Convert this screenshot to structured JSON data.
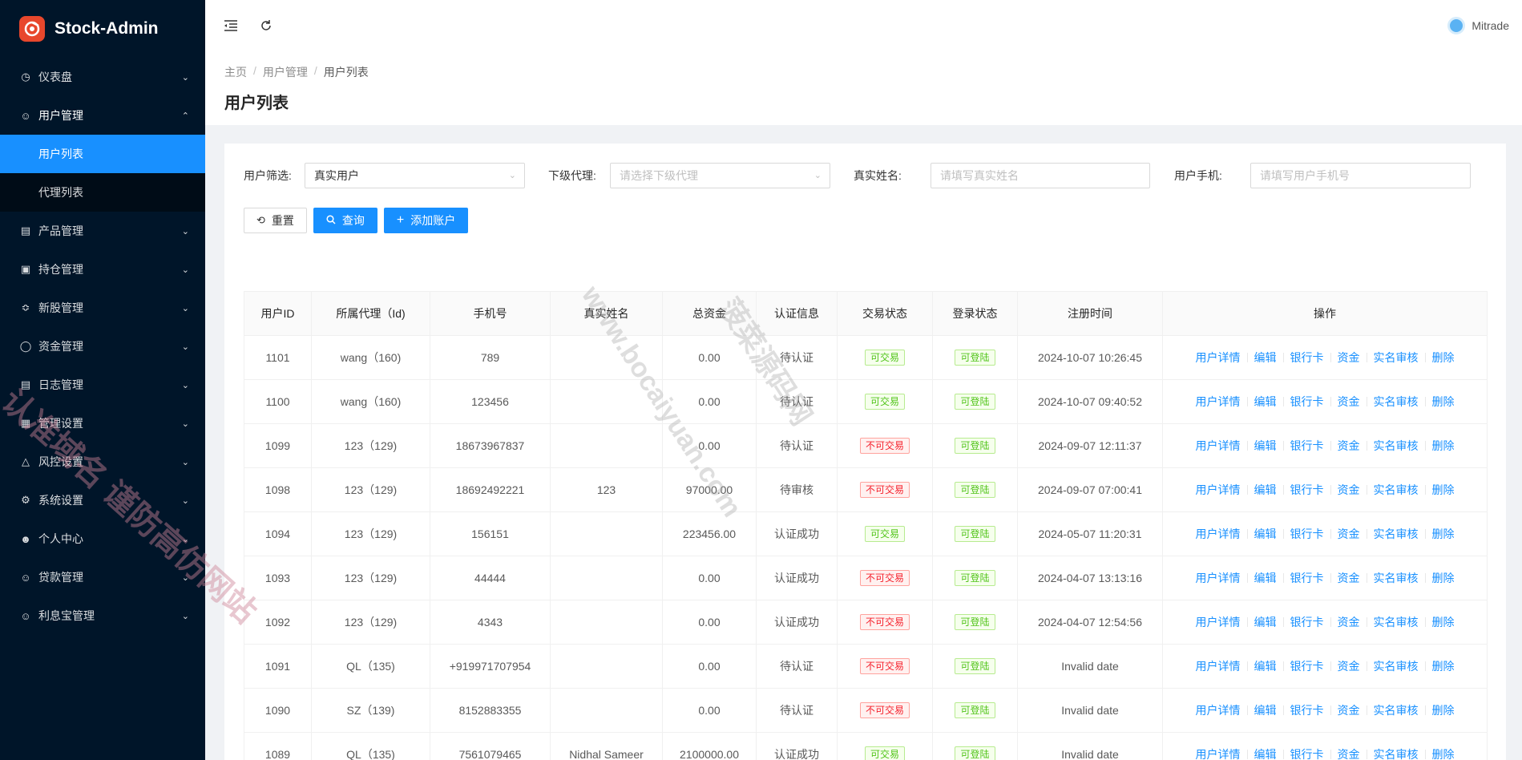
{
  "app": {
    "name": "Stock-Admin"
  },
  "sidebar": {
    "items": [
      {
        "label": "仪表盘",
        "icon": "dashboard-icon"
      },
      {
        "label": "用户管理",
        "icon": "user-group-icon",
        "open": true,
        "children": [
          {
            "label": "用户列表",
            "active": true
          },
          {
            "label": "代理列表"
          }
        ]
      },
      {
        "label": "产品管理",
        "icon": "bar-chart-icon"
      },
      {
        "label": "持仓管理",
        "icon": "position-icon"
      },
      {
        "label": "新股管理",
        "icon": "new-stock-icon"
      },
      {
        "label": "资金管理",
        "icon": "money-icon"
      },
      {
        "label": "日志管理",
        "icon": "log-icon"
      },
      {
        "label": "管理设置",
        "icon": "admin-settings-icon"
      },
      {
        "label": "风控设置",
        "icon": "warning-icon"
      },
      {
        "label": "系统设置",
        "icon": "gear-icon"
      },
      {
        "label": "个人中心",
        "icon": "user-icon"
      },
      {
        "label": "贷款管理",
        "icon": "loan-icon"
      },
      {
        "label": "利息宝管理",
        "icon": "interest-icon"
      }
    ]
  },
  "header": {
    "username": "Mitrade"
  },
  "breadcrumb": [
    "主页",
    "用户管理",
    "用户列表"
  ],
  "page_title": "用户列表",
  "filters": {
    "user_filter_label": "用户筛选:",
    "user_filter_value": "真实用户",
    "agent_label": "下级代理:",
    "agent_placeholder": "请选择下级代理",
    "realname_label": "真实姓名:",
    "realname_placeholder": "请填写真实姓名",
    "phone_label": "用户手机:",
    "phone_placeholder": "请填写用户手机号"
  },
  "buttons": {
    "reset": "重置",
    "query": "查询",
    "add": "添加账户"
  },
  "table": {
    "columns": [
      "用户ID",
      "所属代理（Id)",
      "手机号",
      "真实姓名",
      "总资金",
      "认证信息",
      "交易状态",
      "登录状态",
      "注册时间",
      "操作"
    ],
    "actions": [
      "用户详情",
      "编辑",
      "银行卡",
      "资金",
      "实名审核",
      "删除"
    ],
    "rows": [
      {
        "id": "1101",
        "agent": "wang（160)",
        "phone": "789",
        "name": "",
        "funds": "0.00",
        "auth": "待认证",
        "trade": "可交易",
        "trade_ok": true,
        "login": "可登陆",
        "time": "2024-10-07 10:26:45"
      },
      {
        "id": "1100",
        "agent": "wang（160)",
        "phone": "123456",
        "name": "",
        "funds": "0.00",
        "auth": "待认证",
        "trade": "可交易",
        "trade_ok": true,
        "login": "可登陆",
        "time": "2024-10-07 09:40:52"
      },
      {
        "id": "1099",
        "agent": "123（129)",
        "phone": "18673967837",
        "name": "",
        "funds": "0.00",
        "auth": "待认证",
        "trade": "不可交易",
        "trade_ok": false,
        "login": "可登陆",
        "time": "2024-09-07 12:11:37"
      },
      {
        "id": "1098",
        "agent": "123（129)",
        "phone": "18692492221",
        "name": "123",
        "funds": "97000.00",
        "auth": "待审核",
        "trade": "不可交易",
        "trade_ok": false,
        "login": "可登陆",
        "time": "2024-09-07 07:00:41"
      },
      {
        "id": "1094",
        "agent": "123（129)",
        "phone": "156151",
        "name": "",
        "funds": "223456.00",
        "auth": "认证成功",
        "trade": "可交易",
        "trade_ok": true,
        "login": "可登陆",
        "time": "2024-05-07 11:20:31"
      },
      {
        "id": "1093",
        "agent": "123（129)",
        "phone": "44444",
        "name": "",
        "funds": "0.00",
        "auth": "认证成功",
        "trade": "不可交易",
        "trade_ok": false,
        "login": "可登陆",
        "time": "2024-04-07 13:13:16"
      },
      {
        "id": "1092",
        "agent": "123（129)",
        "phone": "4343",
        "name": "",
        "funds": "0.00",
        "auth": "认证成功",
        "trade": "不可交易",
        "trade_ok": false,
        "login": "可登陆",
        "time": "2024-04-07 12:54:56"
      },
      {
        "id": "1091",
        "agent": "QL（135)",
        "phone": "+919971707954",
        "name": "",
        "funds": "0.00",
        "auth": "待认证",
        "trade": "不可交易",
        "trade_ok": false,
        "login": "可登陆",
        "time": "Invalid date"
      },
      {
        "id": "1090",
        "agent": "SZ（139)",
        "phone": "8152883355",
        "name": "",
        "funds": "0.00",
        "auth": "待认证",
        "trade": "不可交易",
        "trade_ok": false,
        "login": "可登陆",
        "time": "Invalid date"
      },
      {
        "id": "1089",
        "agent": "QL（135)",
        "phone": "7561079465",
        "name": "Nidhal Sameer",
        "funds": "2100000.00",
        "auth": "认证成功",
        "trade": "可交易",
        "trade_ok": true,
        "login": "可登陆",
        "time": "Invalid date"
      }
    ]
  },
  "watermarks": [
    "认准域名 谨防高仿网站",
    "www.bocaiyuan.com",
    "菠菜源码网"
  ],
  "colors": {
    "sidebar_bg": "#001529",
    "primary": "#1890ff",
    "tag_green": "#52c41a",
    "tag_red": "#f5222d"
  }
}
